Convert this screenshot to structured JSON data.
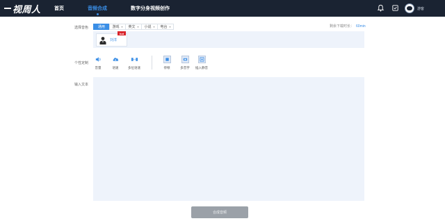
{
  "header": {
    "logo": "视周人",
    "nav": [
      "首页",
      "音频合成",
      "数字分身视频创作"
    ],
    "active_nav": "音频合成",
    "username": "游客"
  },
  "voice": {
    "label": "选择音色",
    "tabs": [
      "通用",
      "游戏",
      "英文",
      "小说",
      "电台"
    ],
    "active_tab": "通用",
    "remain_label": "剩余下载时长：",
    "remain_value": "60min",
    "card": {
      "name": "刘洋",
      "badge": "hot"
    }
  },
  "custom": {
    "label": "个性定制",
    "tools": [
      "音量",
      "语速",
      "多位语速"
    ],
    "tools2": [
      "停顿",
      "多音字",
      "插入静音"
    ]
  },
  "input": {
    "label": "输入文本",
    "value": "",
    "placeholder": ""
  },
  "submit_label": "合成音频",
  "colors": {
    "topbar": "#1a2332",
    "accent": "#3a8ee6",
    "panel": "#eef3fb",
    "badge": "#d9242b",
    "button": "#9ba1a8"
  }
}
